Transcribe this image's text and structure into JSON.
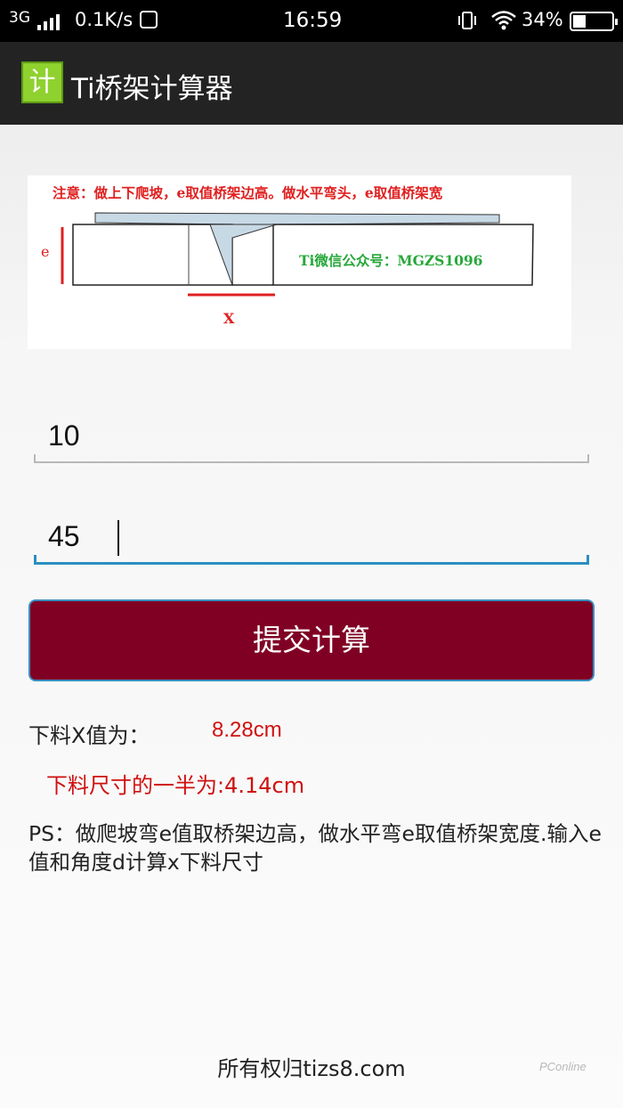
{
  "status_bar": {
    "network": "3G",
    "speed": "0.1K/s",
    "time": "16:59",
    "battery": "34%",
    "battery_level": 0.34
  },
  "app_bar": {
    "icon_char": "计",
    "title": "Ti桥架计算器"
  },
  "diagram": {
    "note": "注意：做上下爬坡，e取值桥架边高。做水平弯头，e取值桥架宽",
    "e_label": "e",
    "x_label": "X",
    "wechat": "Ti微信公众号：MGZS1096"
  },
  "inputs": {
    "e_value": "10",
    "angle_value": "45"
  },
  "submit_label": "提交计算",
  "results": {
    "x_label": "下料X值为：",
    "x_value": "8.28cm",
    "half": "下料尺寸的一半为:4.14cm"
  },
  "ps_note": "PS：做爬坡弯e值取桥架边高，做水平弯e取值桥架宽度.输入e值和角度d计算x下料尺寸",
  "footer": "所有权归tizs8.com",
  "watermark": "PConline",
  "colors": {
    "button": "#800024",
    "accent_focus": "#2b8fbf",
    "result_red": "#d01010",
    "app_icon": "#8fd12e"
  }
}
